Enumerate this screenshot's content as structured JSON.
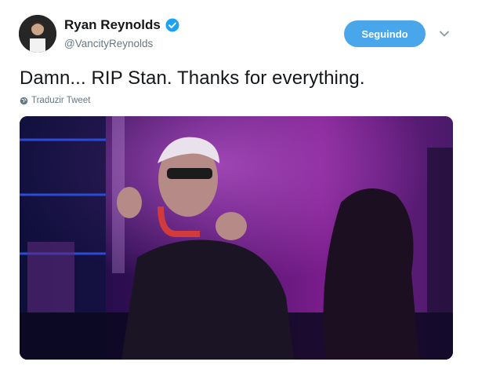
{
  "author": {
    "display_name": "Ryan Reynolds",
    "handle": "@VancityReynolds",
    "verified": true
  },
  "follow_button": {
    "label": "Seguindo"
  },
  "tweet": {
    "text": "Damn... RIP Stan. Thanks for everything.",
    "translate_label": "Traduzir Tweet"
  },
  "icons": {
    "verified": "verified-badge-icon",
    "caret": "chevron-down-icon",
    "globe": "globe-icon"
  },
  "colors": {
    "accent": "#4aa6ea",
    "verified": "#1da1f2",
    "secondary_text": "#657786"
  }
}
